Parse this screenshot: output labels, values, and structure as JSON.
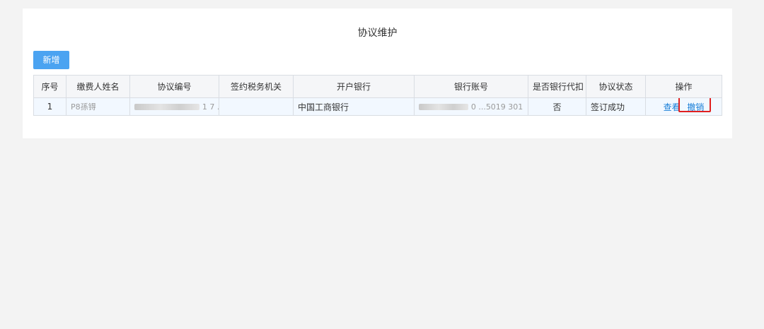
{
  "page": {
    "title": "协议维护"
  },
  "toolbar": {
    "add_label": "新增"
  },
  "table": {
    "columns": [
      "序号",
      "缴费人姓名",
      "协议编号",
      "签约税务机关",
      "开户银行",
      "银行账号",
      "是否银行代扣",
      "协议状态",
      "操作"
    ],
    "rows": [
      {
        "index": "1",
        "payer_name": "P8孫锝",
        "agreement_no": "1 7 .",
        "tax_office": "",
        "bank": "中国工商银行",
        "account": "0 ...5019 301",
        "bank_withholding": "否",
        "status": "签订成功",
        "actions": {
          "view": "查看",
          "revoke": "撤销"
        }
      }
    ]
  },
  "colors": {
    "accent": "#4ba3f1",
    "link": "#1a7fd8",
    "highlight": "#e02020"
  }
}
